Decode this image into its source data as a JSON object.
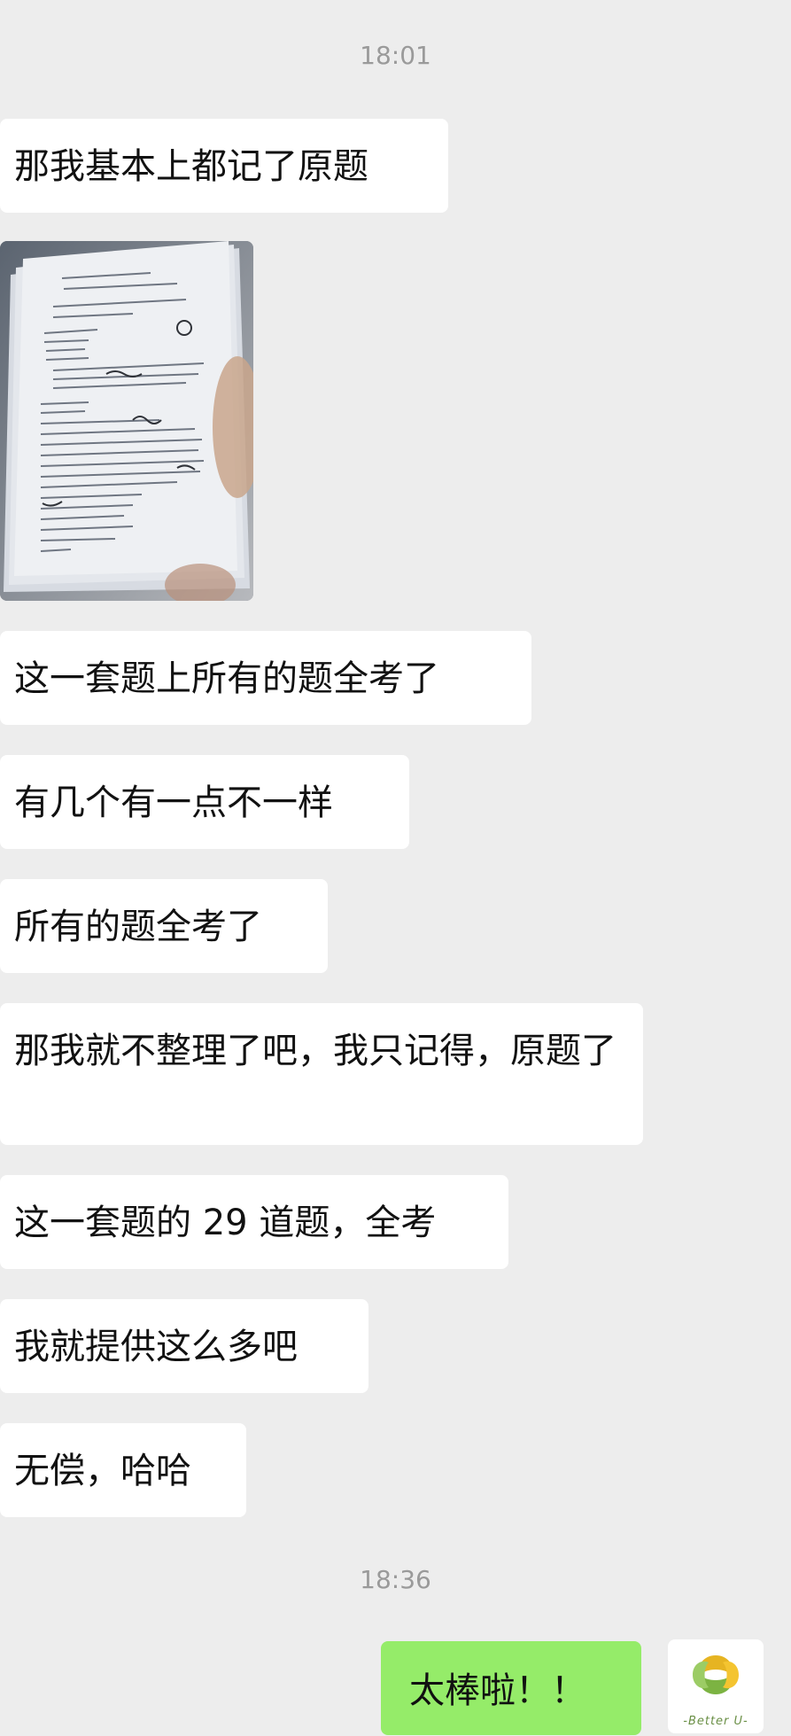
{
  "timestamps": [
    "18:01",
    "18:36"
  ],
  "messages_in": [
    "那我基本上都记了原题",
    "这一套题上所有的题全考了",
    "有几个有一点不一样",
    "所有的题全考了",
    "那我就不整理了吧，我只记得，原题了",
    "这一套题的 29 道题，全考",
    "我就提供这么多吧",
    "无偿，哈哈"
  ],
  "message_out": "太棒啦！！",
  "avatar": {
    "caption": "-Better U-",
    "icon": "better-u-logo-icon"
  },
  "photo": {
    "icon": "exam-paper-photo-icon"
  },
  "colors": {
    "background": "#ededed",
    "bubble_in": "#ffffff",
    "bubble_out": "#95ec69",
    "timestamp": "#9a9a9a"
  }
}
